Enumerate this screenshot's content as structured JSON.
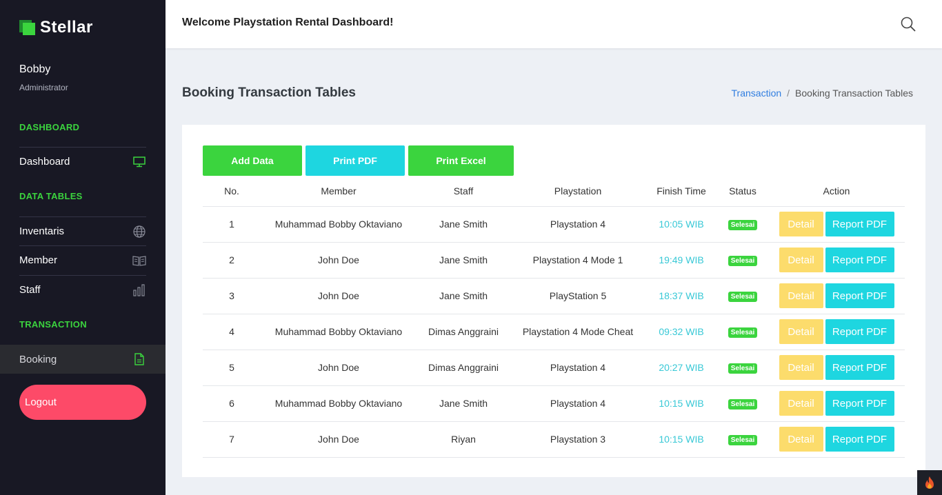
{
  "brand": {
    "name": "Stellar"
  },
  "user": {
    "name": "Bobby",
    "role": "Administrator"
  },
  "sidebar": {
    "sections": [
      {
        "title": "DASHBOARD"
      },
      {
        "title": "DATA TABLES"
      },
      {
        "title": "TRANSACTION"
      }
    ],
    "items": [
      {
        "label": "Dashboard",
        "icon": "monitor-icon"
      },
      {
        "label": "Inventaris",
        "icon": "globe-icon"
      },
      {
        "label": "Member",
        "icon": "book-icon"
      },
      {
        "label": "Staff",
        "icon": "bar-chart-icon"
      },
      {
        "label": "Booking",
        "icon": "file-icon"
      }
    ],
    "logout_label": "Logout"
  },
  "header": {
    "welcome": "Welcome Playstation Rental Dashboard!"
  },
  "page": {
    "title": "Booking Transaction Tables",
    "breadcrumb": {
      "link": "Transaction",
      "separator": "/",
      "current": "Booking Transaction Tables"
    }
  },
  "buttons": {
    "add": "Add Data",
    "print_pdf": "Print PDF",
    "print_excel": "Print Excel"
  },
  "table": {
    "headers": [
      "No.",
      "Member",
      "Staff",
      "Playstation",
      "Finish Time",
      "Status",
      "Action"
    ],
    "rows": [
      {
        "no": "1",
        "member": "Muhammad Bobby Oktaviano",
        "staff": "Jane Smith",
        "playstation": "Playstation 4",
        "finish": "10:05 WIB",
        "status": "Selesai"
      },
      {
        "no": "2",
        "member": "John Doe",
        "staff": "Jane Smith",
        "playstation": "Playstation 4 Mode 1",
        "finish": "19:49 WIB",
        "status": "Selesai"
      },
      {
        "no": "3",
        "member": "John Doe",
        "staff": "Jane Smith",
        "playstation": "PlayStation 5",
        "finish": "18:37 WIB",
        "status": "Selesai"
      },
      {
        "no": "4",
        "member": "Muhammad Bobby Oktaviano",
        "staff": "Dimas Anggraini",
        "playstation": "Playstation 4 Mode Cheat",
        "finish": "09:32 WIB",
        "status": "Selesai"
      },
      {
        "no": "5",
        "member": "John Doe",
        "staff": "Dimas Anggraini",
        "playstation": "Playstation 4",
        "finish": "20:27 WIB",
        "status": "Selesai"
      },
      {
        "no": "6",
        "member": "Muhammad Bobby Oktaviano",
        "staff": "Jane Smith",
        "playstation": "Playstation 4",
        "finish": "10:15 WIB",
        "status": "Selesai"
      },
      {
        "no": "7",
        "member": "John Doe",
        "staff": "Riyan",
        "playstation": "Playstation 3",
        "finish": "10:15 WIB",
        "status": "Selesai"
      }
    ],
    "actions": {
      "detail": "Detail",
      "report": "Report PDF"
    }
  },
  "colors": {
    "accent_green": "#3bd43e",
    "accent_cyan": "#1ed6e0",
    "detail_yellow": "#fcdc6c",
    "logout_pink": "#fd4a68",
    "sidebar_bg": "#181824"
  }
}
